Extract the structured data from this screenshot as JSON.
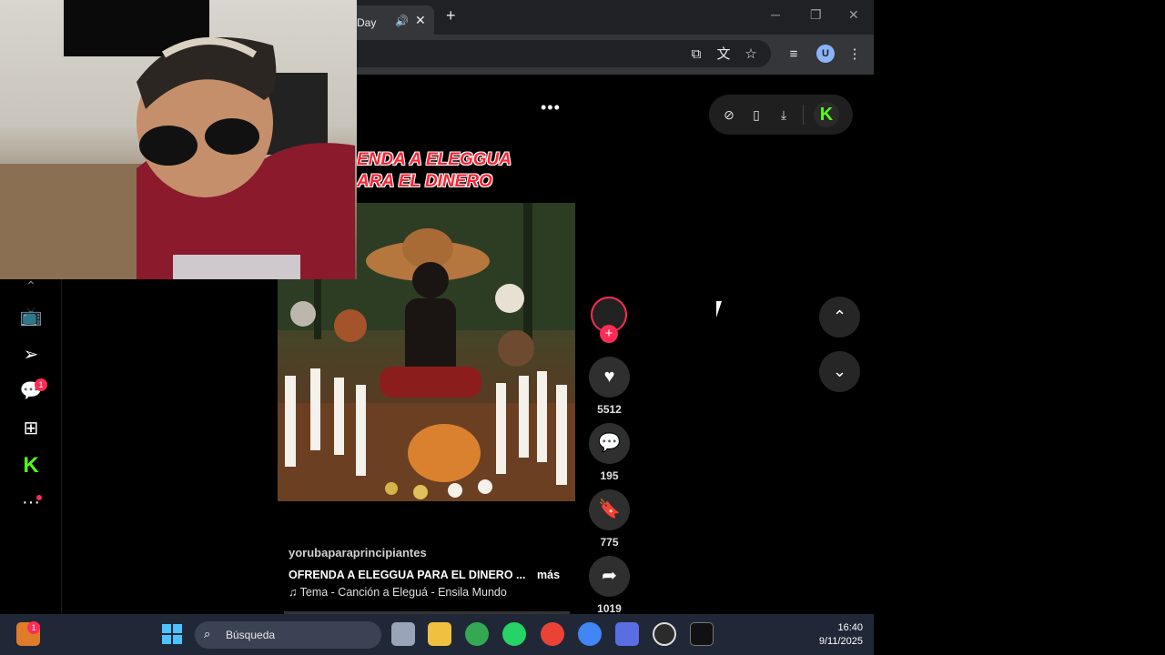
{
  "browser": {
    "tab_title": "Day",
    "window_controls": {
      "minimize": "─",
      "restore": "❐",
      "close": "✕"
    }
  },
  "page": {
    "menu_dots": "•••",
    "video": {
      "overlay_title_line1": "ENDA A ELEGGUA",
      "overlay_title_line2": "ARA EL DINERO",
      "username": "yorubaparaprincipiantes",
      "description": "OFRENDA A ELEGGUA PARA EL DINERO ...",
      "more_label": "más",
      "music": "♫  Tema - Canción a Eleguá - Ensila Mundo"
    },
    "actions": {
      "likes": "5512",
      "comments": "195",
      "saves": "775",
      "shares": "1019"
    },
    "sidebar": {
      "messages_badge": "1"
    }
  },
  "taskbar": {
    "search_placeholder": "Búsqueda",
    "time": "16:40",
    "date": "9/11/2025",
    "widget_badge": "1"
  },
  "colors": {
    "accent": "#fe2c55",
    "kick_green": "#53fc18"
  }
}
